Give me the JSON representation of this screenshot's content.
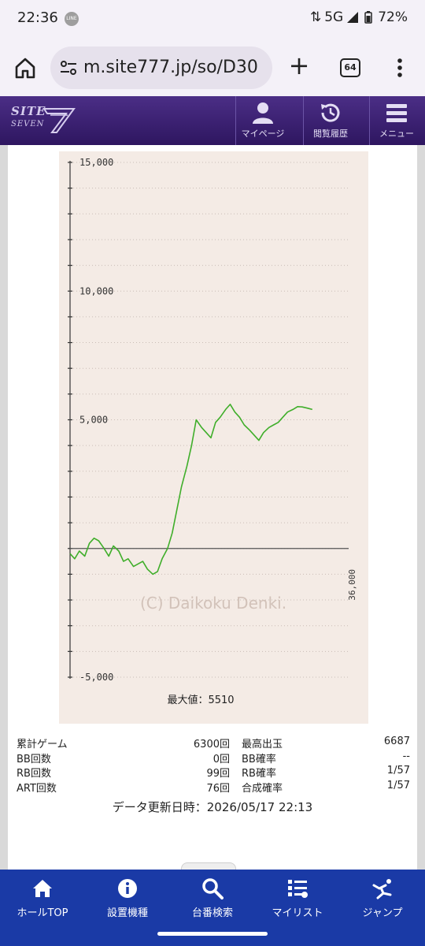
{
  "status_bar": {
    "time": "22:36",
    "line_badge": "LINE",
    "network": "5G",
    "battery": "72%"
  },
  "browser": {
    "url": "m.site777.jp/so/D30",
    "tab_count": "64"
  },
  "site_header": {
    "logo_site": "SITE",
    "logo_seven": "SEVEN",
    "buttons": [
      {
        "label": "マイページ",
        "icon": "person-icon"
      },
      {
        "label": "閲覧履歴",
        "icon": "history-icon"
      },
      {
        "label": "メニュー",
        "icon": "hamburger-icon"
      }
    ]
  },
  "chart_data": {
    "type": "line",
    "y_tick_labels": [
      "15,000",
      "10,000",
      "5,000",
      "-5,000"
    ],
    "y_ticks": [
      15000,
      10000,
      5000,
      -5000
    ],
    "ylim": [
      -5000,
      15000
    ],
    "x_end_label": "36,000",
    "xlim": [
      0,
      36000
    ],
    "watermark": "(C) Daikoku Denki.",
    "max_label": "最大値：5510",
    "grid": true,
    "line_color": "#3fae2a",
    "series": [
      {
        "x": [
          0,
          600,
          1200,
          1900,
          2500,
          3100,
          3700,
          4400,
          5000,
          5600,
          6300,
          6900,
          7500,
          8200,
          8800,
          9400,
          10000,
          10700,
          11300,
          11900,
          12600,
          13200,
          13800,
          14400,
          15100,
          15700,
          16300,
          17000,
          17600,
          18200,
          18800,
          19400,
          20100,
          20700,
          21300,
          21900,
          22500,
          23200,
          23800,
          24400,
          25000,
          25700,
          26300,
          26900,
          27500,
          28100,
          28800,
          29400,
          30000,
          30700,
          31300
        ],
        "y": [
          -200,
          -400,
          -100,
          -300,
          200,
          400,
          300,
          0,
          -300,
          100,
          -100,
          -500,
          -400,
          -700,
          -600,
          -500,
          -800,
          -1000,
          -900,
          -400,
          0,
          600,
          1500,
          2400,
          3200,
          4000,
          5000,
          4700,
          4500,
          4300,
          4900,
          5100,
          5400,
          5600,
          5300,
          5100,
          4800,
          4600,
          4400,
          4200,
          4500,
          4700,
          4800,
          4900,
          5100,
          5300,
          5400,
          5510,
          5500,
          5450,
          5400
        ]
      }
    ]
  },
  "stats": {
    "rows": [
      {
        "l1": "累計ゲーム",
        "v1": "6300回",
        "l2": "最高出玉",
        "v2": "6687"
      },
      {
        "l1": "BB回数",
        "v1": "0回",
        "l2": "BB確率",
        "v2": "--"
      },
      {
        "l1": "RB回数",
        "v1": "99回",
        "l2": "RB確率",
        "v2": "1/57"
      },
      {
        "l1": "ART回数",
        "v1": "76回",
        "l2": "合成確率",
        "v2": "1/57"
      }
    ],
    "updated": "データ更新日時：2026/05/17 22:13"
  },
  "bottom_nav": [
    {
      "label": "ホールTOP",
      "icon": "home-icon"
    },
    {
      "label": "設置機種",
      "icon": "info-icon"
    },
    {
      "label": "台番検索",
      "icon": "search-icon"
    },
    {
      "label": "マイリスト",
      "icon": "list-icon"
    },
    {
      "label": "ジャンプ",
      "icon": "jump-icon"
    }
  ]
}
